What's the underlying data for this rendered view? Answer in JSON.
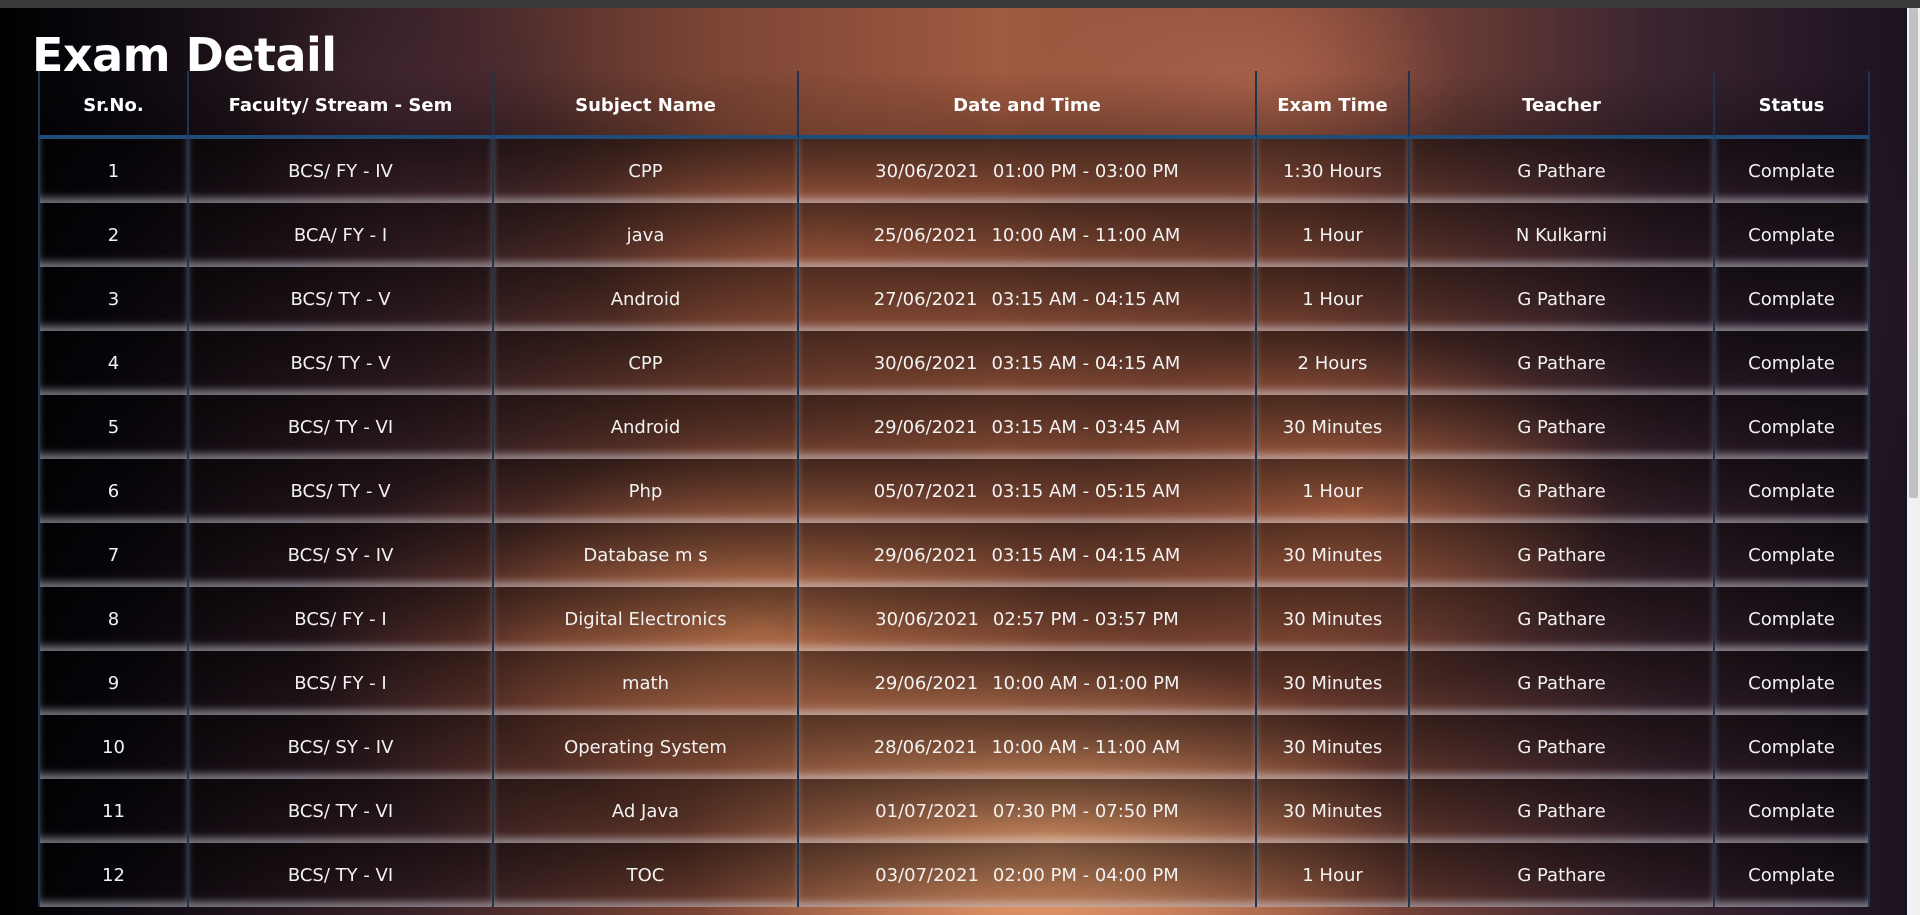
{
  "page": {
    "title": "Exam Detail"
  },
  "table": {
    "headers": [
      "Sr.No.",
      "Faculty/ Stream - Sem",
      "Subject Name",
      "Date and Time",
      "Exam Time",
      "Teacher",
      "Status"
    ],
    "rows": [
      {
        "sr": "1",
        "faculty": "BCS/ FY - IV",
        "subject": "CPP",
        "date": "30/06/2021",
        "time": "01:00 PM - 03:00 PM",
        "duration": "1:30 Hours",
        "teacher": "G Pathare",
        "status": "Complate"
      },
      {
        "sr": "2",
        "faculty": "BCA/ FY - I",
        "subject": "java",
        "date": "25/06/2021",
        "time": "10:00 AM - 11:00 AM",
        "duration": "1 Hour",
        "teacher": "N Kulkarni",
        "status": "Complate"
      },
      {
        "sr": "3",
        "faculty": "BCS/ TY - V",
        "subject": "Android",
        "date": "27/06/2021",
        "time": "03:15 AM - 04:15 AM",
        "duration": "1 Hour",
        "teacher": "G Pathare",
        "status": "Complate"
      },
      {
        "sr": "4",
        "faculty": "BCS/ TY - V",
        "subject": "CPP",
        "date": "30/06/2021",
        "time": "03:15 AM - 04:15 AM",
        "duration": "2 Hours",
        "teacher": "G Pathare",
        "status": "Complate"
      },
      {
        "sr": "5",
        "faculty": "BCS/ TY - VI",
        "subject": "Android",
        "date": "29/06/2021",
        "time": "03:15 AM - 03:45 AM",
        "duration": "30 Minutes",
        "teacher": "G Pathare",
        "status": "Complate"
      },
      {
        "sr": "6",
        "faculty": "BCS/ TY - V",
        "subject": "Php",
        "date": "05/07/2021",
        "time": "03:15 AM - 05:15 AM",
        "duration": "1 Hour",
        "teacher": "G Pathare",
        "status": "Complate"
      },
      {
        "sr": "7",
        "faculty": "BCS/ SY - IV",
        "subject": "Database m s",
        "date": "29/06/2021",
        "time": "03:15 AM - 04:15 AM",
        "duration": "30 Minutes",
        "teacher": "G Pathare",
        "status": "Complate"
      },
      {
        "sr": "8",
        "faculty": "BCS/ FY - I",
        "subject": "Digital Electronics",
        "date": "30/06/2021",
        "time": "02:57 PM - 03:57 PM",
        "duration": "30 Minutes",
        "teacher": "G Pathare",
        "status": "Complate"
      },
      {
        "sr": "9",
        "faculty": "BCS/ FY - I",
        "subject": "math",
        "date": "29/06/2021",
        "time": "10:00 AM - 01:00 PM",
        "duration": "30 Minutes",
        "teacher": "G Pathare",
        "status": "Complate"
      },
      {
        "sr": "10",
        "faculty": "BCS/ SY - IV",
        "subject": "Operating System",
        "date": "28/06/2021",
        "time": "10:00 AM - 11:00 AM",
        "duration": "30 Minutes",
        "teacher": "G Pathare",
        "status": "Complate"
      },
      {
        "sr": "11",
        "faculty": "BCS/ TY - VI",
        "subject": "Ad Java",
        "date": "01/07/2021",
        "time": "07:30 PM - 07:50 PM",
        "duration": "30 Minutes",
        "teacher": "G Pathare",
        "status": "Complate"
      },
      {
        "sr": "12",
        "faculty": "BCS/ TY - VI",
        "subject": "TOC",
        "date": "03/07/2021",
        "time": "02:00 PM - 04:00 PM",
        "duration": "1 Hour",
        "teacher": "G Pathare",
        "status": "Complate"
      }
    ]
  }
}
